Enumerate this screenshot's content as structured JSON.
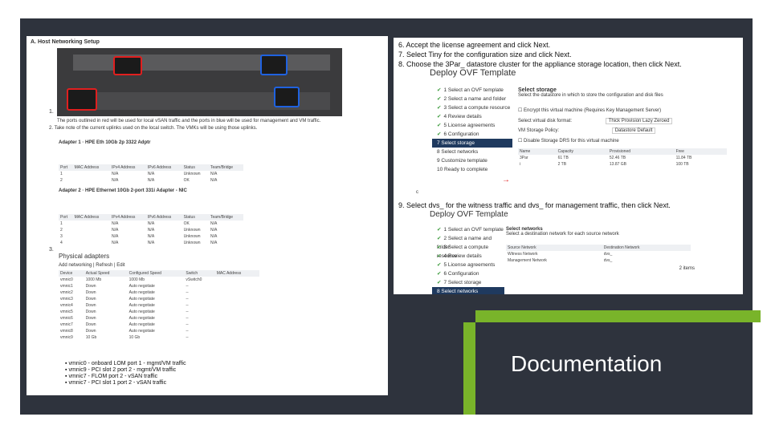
{
  "slide_title": "Documentation",
  "left": {
    "heading": "A. Host Networking Setup",
    "step1_num": "1.",
    "step1_text": "The ports outlined in red will be used for local vSAN traffic and the ports in blue will be used for management and VM traffic.",
    "step2_text": "2. Take note of the current uplinks used on the local switch. The VMKs will be using those uplinks.",
    "adapter1": "Adapter 1 · HPE Eth 10Gb 2p 3322 Adptr",
    "adapter2": "Adapter 2 · HPE Ethernet 10Gb 2-port 331i Adapter - NIC",
    "nic_headers": [
      "Port",
      "MAC Address",
      "IPv4 Address",
      "IPv6 Address",
      "Status",
      "Team/Bridge"
    ],
    "nic_rows1": [
      [
        "1",
        "",
        "N/A",
        "N/A",
        "Unknown",
        "N/A"
      ],
      [
        "2",
        "",
        "N/A",
        "N/A",
        "OK",
        "N/A"
      ]
    ],
    "nic_rows2": [
      [
        "1",
        "",
        "N/A",
        "N/A",
        "OK",
        "N/A"
      ],
      [
        "2",
        "",
        "N/A",
        "N/A",
        "Unknown",
        "N/A"
      ],
      [
        "3",
        "",
        "N/A",
        "N/A",
        "Unknown",
        "N/A"
      ],
      [
        "4",
        "",
        "N/A",
        "N/A",
        "Unknown",
        "N/A"
      ]
    ],
    "step3_num": "3.",
    "physical_adapters_title": "Physical adapters",
    "pa_toolbar": [
      "Add networking",
      "Refresh",
      "Edit"
    ],
    "pa_headers": [
      "Device",
      "Actual Speed",
      "Configured Speed",
      "Switch",
      "MAC Address"
    ],
    "pa_rows": [
      [
        "vmnic0",
        "1000 Mb",
        "1000 Mb",
        "vSwitch0",
        ""
      ],
      [
        "vmnic1",
        "Down",
        "Auto negotiate",
        "--",
        ""
      ],
      [
        "vmnic2",
        "Down",
        "Auto negotiate",
        "--",
        ""
      ],
      [
        "vmnic3",
        "Down",
        "Auto negotiate",
        "--",
        ""
      ],
      [
        "vmnic4",
        "Down",
        "Auto negotiate",
        "--",
        ""
      ],
      [
        "vmnic5",
        "Down",
        "Auto negotiate",
        "--",
        ""
      ],
      [
        "vmnic6",
        "Down",
        "Auto negotiate",
        "--",
        ""
      ],
      [
        "vmnic7",
        "Down",
        "Auto negotiate",
        "--",
        ""
      ],
      [
        "vmnic8",
        "Down",
        "Auto negotiate",
        "--",
        ""
      ],
      [
        "vmnic9",
        "10 Gb",
        "10 Gb",
        "--",
        ""
      ]
    ],
    "bullets": [
      "vmnic0 - onboard LOM port 1 - mgmt/VM traffic",
      "vmnic9 - PCI slot 2 port 2 - mgmt/VM traffic",
      "vmnic7 - FLOM port 2 - vSAN traffic",
      "vmnic7 - PCI slot 1 port 2 - vSAN traffic"
    ]
  },
  "right": {
    "step6": "6. Accept the license agreement and click Next.",
    "step7": "7. Select Tiny for the configuration size and click Next.",
    "step8": "8. Choose the 3Par_  datastore cluster for the appliance storage location, then click Next.",
    "wizard_title": "Deploy OVF Template",
    "wizard_steps": [
      "1 Select an OVF template",
      "2 Select a name and folder",
      "3 Select a compute resource",
      "4 Review details",
      "5 License agreements",
      "6 Configuration",
      "7 Select storage",
      "8 Select networks",
      "9 Customize template",
      "10 Ready to complete"
    ],
    "storage_heading": "Select storage",
    "storage_sub": "Select the datastore in which to store the configuration and disk files",
    "encrypt_label": "Encrypt this virtual machine (Requires Key Management Server)",
    "disk_format_label": "Select virtual disk format:",
    "disk_format_value": "Thick Provision Lazy Zeroed",
    "vm_policy_label": "VM Storage Policy:",
    "vm_policy_value": "Datastore Default",
    "drs_label": "Disable Storage DRS for this virtual machine",
    "ds_headers": [
      "Name",
      "Capacity",
      "Provisioned",
      "Free"
    ],
    "ds_rows": [
      [
        "3Par",
        "61 TB",
        "52.46 TB",
        "11.84 TB"
      ],
      [
        "i",
        "2 TB",
        "13.87 GB",
        "100 TB"
      ]
    ],
    "compat_letter": "c",
    "step9": "9. Select dvs_   for the witness traffic and dvs_   for management traffic, then click Next.",
    "wizard2_title": "Deploy OVF Template",
    "wizard2_steps": [
      "1 Select an OVF template",
      "2 Select a name and folder",
      "3 Select a compute resource",
      "4 Review details",
      "5 License agreements",
      "6 Configuration",
      "7 Select storage",
      "8 Select networks",
      "9 Customize template"
    ],
    "net_heading": "Select networks",
    "net_sub": "Select a destination network for each source network",
    "net_headers": [
      "Source Network",
      "Destination Network"
    ],
    "net_rows": [
      [
        "Witness Network",
        "dvs_"
      ],
      [
        "Management Network",
        "dvs_"
      ]
    ],
    "net_count": "2 items"
  },
  "colors": {
    "frame": "#2e333d",
    "accent_green": "#79b42a",
    "port_red": "#e01f1f",
    "port_blue": "#1f62e0",
    "wizard_active": "#1f3a5f"
  }
}
